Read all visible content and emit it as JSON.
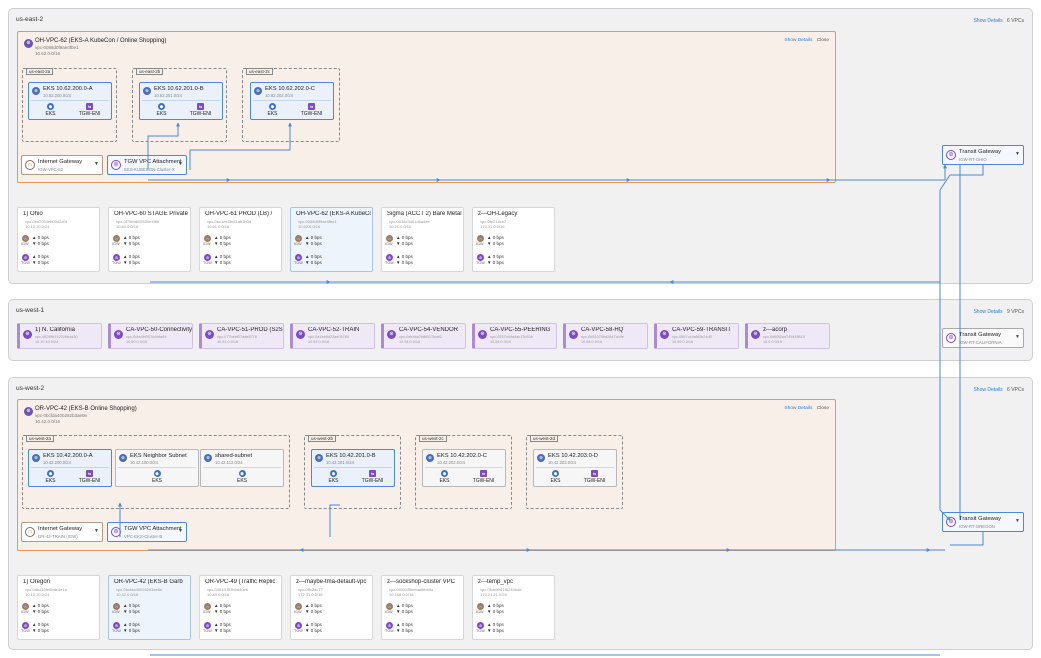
{
  "colors": {
    "link": "#2f7ad6",
    "vpc_border": "#e39a55",
    "vpc_bg": "#f8efe9",
    "subnet_border": "#4a89d8",
    "tgw": "#7b4cc2",
    "line": "#4a89d8"
  },
  "icons": {
    "subnet": "subnet-icon",
    "eks": "eks-icon",
    "tgw_eni": "tgw-eni-icon",
    "igw": "internet-gateway-icon",
    "tgw_attach": "tgw-attachment-icon",
    "tgw": "transit-gateway-icon"
  },
  "labels": {
    "show_details": "Show Details",
    "close": "Close",
    "eks": "EKS",
    "tgw_eni": "TGW-ENI",
    "zero_bps": "0 bps",
    "igw": "IGW",
    "tgw": "TGW"
  },
  "regions": [
    {
      "name": "us-east-2",
      "vpc_count": "6 VPCs",
      "expanded_vpc": {
        "title": "OH-VPC-62 (EKS-A KubeCon / Online Shopping)",
        "id": "vpc-0088d0f9ae0fbe1",
        "cidr": "10.62.0.0/16",
        "azs": [
          "us-east-2a",
          "us-east-2b",
          "us-east-2c"
        ],
        "subnets": [
          {
            "name": "EKS 10.62.200.0-A",
            "cidr": "10.62.200.0/24"
          },
          {
            "name": "EKS 10.62.201.0-B",
            "cidr": "10.62.201.0/24"
          },
          {
            "name": "EKS 10.62.202.0-C",
            "cidr": "10.62.202.0/24"
          }
        ],
        "igw": {
          "name": "Internet Gateway",
          "sub": "IGW-VPC-62"
        },
        "tgw_attachment": {
          "name": "TGW VPC Attachment",
          "sub": "EKS-KUBECON-Cluster-X"
        }
      },
      "tgw": {
        "name": "Transit Gateway",
        "sub": "IGW-RT-OHIO"
      },
      "vpcs": [
        {
          "name": "1) Ohio",
          "id": "vpc-0bc7054eb03d2d0f",
          "cidr": "10.10.10.0/24"
        },
        {
          "name": "OH-VPC-60 STAGE Private",
          "id": "vpc-0f75bab05530e4f6b",
          "cidr": "10.60.0.0/16"
        },
        {
          "name": "OH-VPC-61 PROD (LB) /",
          "id": "vpc-0bc1ee3fe61ab1b0d",
          "cidr": "10.61.0.0/16"
        },
        {
          "name": "OH-VPC-62 (EKS-A KubeCon",
          "id": "vpc-0088d0f9ae0fbe1",
          "cidr": "10.62.0.0/16"
        },
        {
          "name": "Sigma (ACCT 2) Bare Metal",
          "id": "vpc-0038c3401d6a4ee",
          "cidr": "10.21.0.0/16"
        },
        {
          "name": "z---OH-Legacy",
          "id": "vpc-0fe21dcb7",
          "cidr": "172.31.0.0/16"
        }
      ]
    },
    {
      "name": "us-west-1",
      "vpc_count": "9 VPCs",
      "tgw": {
        "name": "Transit Gateway",
        "sub": "IGW-RT-CALIFORNIA"
      },
      "vpcs": [
        {
          "name": "1) N. California",
          "id": "vpc-0828ffc7c2226b4d30",
          "cidr": "10.10.10.0/24"
        },
        {
          "name": "CA-VPC-50-Connectivity",
          "id": "vpc-00bc9b0f70c0cfa9d",
          "cidr": "10.50.0.0/16"
        },
        {
          "name": "CA-VPC-51-PROD (S2S VPN)",
          "id": "vpc-077bebf27ade5778",
          "cidr": "10.51.0.0/16"
        },
        {
          "name": "CA-VPC-52-TRAIN",
          "id": "vpc-0a1eb9d22ae05780",
          "cidr": "10.52.0.0/16"
        },
        {
          "name": "CA-VPC-54-VENDOR",
          "id": "vpc-0de4ba7b8b523cdb2",
          "cidr": "10.54.0.0/16"
        },
        {
          "name": "CA-VPC-55-PEERING",
          "id": "vpc-0537d49a4ac17b53b",
          "cidr": "10.55.0.0/16"
        },
        {
          "name": "CA-VPC-58-HQ",
          "id": "vpc-0b51070bd2847cb9e",
          "cidr": "10.58.0.0/16"
        },
        {
          "name": "CA-VPC-59-TRANSIT",
          "id": "vpc-05b7c49a5f2b24d5",
          "cidr": "10.59.0.0/16"
        },
        {
          "name": "z---acorp",
          "id": "vpc-0d89f2ad749448610",
          "cidr": "10.0.0.0/16"
        }
      ]
    },
    {
      "name": "us-west-2",
      "vpc_count": "6 VPCs",
      "expanded_vpc": {
        "title": "OR-VPC-42 (EKS-B Online Shopping)",
        "id": "vpc-0bcfda400282b3ae6e",
        "cidr": "10.42.0.0/16",
        "azs": [
          "us-west-2a",
          "us-west-2b",
          "us-west-2c",
          "us-west-2d"
        ],
        "subnets": [
          {
            "name": "EKS 10.42.200.0-A",
            "cidr": "10.42.200.0/24"
          },
          {
            "name": "EKS Neighbor Subnet",
            "cidr": "10.42.100.0/24"
          },
          {
            "name": "shared-subnet",
            "cidr": "10.42.112.0/24"
          },
          {
            "name": "EKS 10.42.201.0-B",
            "cidr": "10.42.201.0/24"
          },
          {
            "name": "EKS 10.42.202.0-C",
            "cidr": "10.42.202.0/24"
          },
          {
            "name": "EKS 10.42.203.0-D",
            "cidr": "10.42.203.0/24"
          }
        ],
        "igw": {
          "name": "Internet Gateway",
          "sub": "OR-42-TRAIN (IGW)"
        },
        "tgw_attachment": {
          "name": "TGW VPC Attachment",
          "sub": "VPC-EKS-Cluster-B"
        }
      },
      "tgw": {
        "name": "Transit Gateway",
        "sub": "IGW-RT-OREGON"
      },
      "vpcs": [
        {
          "name": "1) Oregon",
          "id": "vpc-0dbd10fe8bdc4e1a",
          "cidr": "10.10.10.0/24"
        },
        {
          "name": "OR-VPC-42 (EKS-B Garb",
          "id": "vpc-0bcfda400282b3ae6e",
          "cidr": "10.42.0.0/16"
        },
        {
          "name": "OR-VPC-49 (Traffic Replic",
          "id": "vpc-0461f1f53b0d40e6",
          "cidr": "10.49.0.0/16"
        },
        {
          "name": "z---maybe-tma-default-vpc",
          "id": "vpc-0ffc2ac77",
          "cidr": "172.31.0.0/16"
        },
        {
          "name": "z---sockshop-cluster VPC",
          "id": "vpc-0f00f4f5eeba8bbb5a",
          "cidr": "10.168.0.0/16"
        },
        {
          "name": "z---temp_vpc",
          "id": "vpc-0fcb0fb11f6240bdd",
          "cidr": "172.21.21.0/24"
        }
      ]
    }
  ]
}
